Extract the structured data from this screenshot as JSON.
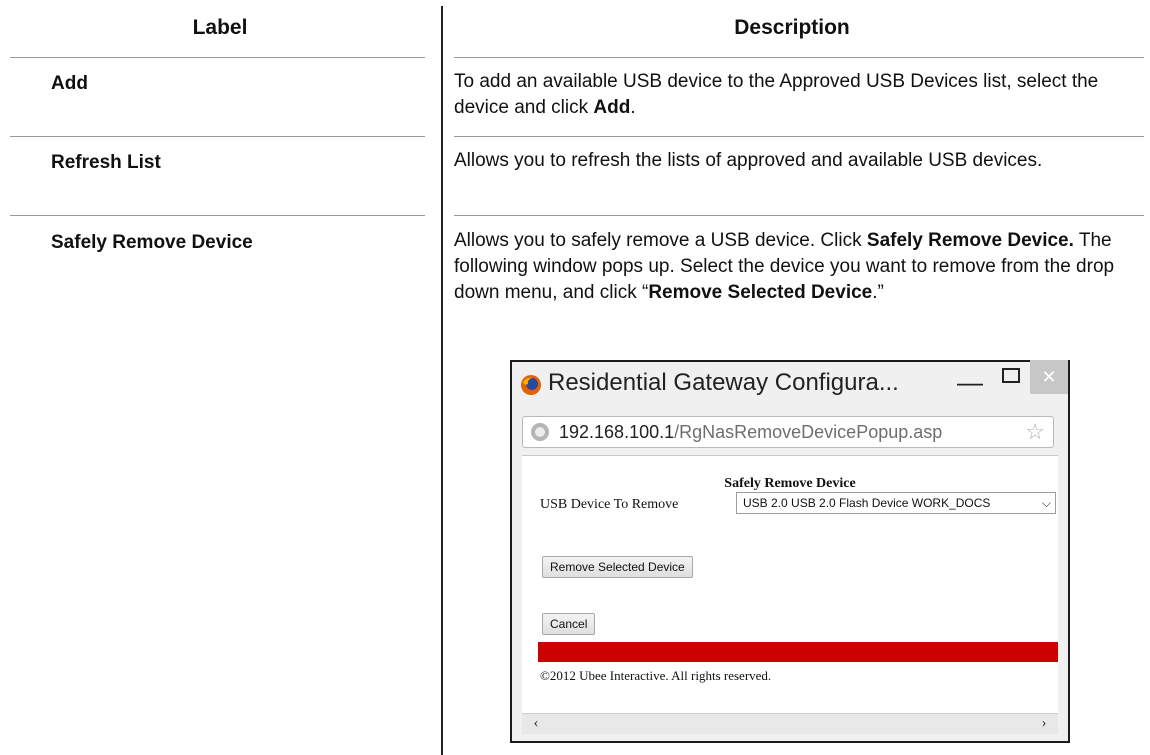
{
  "table": {
    "header_label": "Label",
    "header_description": "Description",
    "rows": [
      {
        "label": "Add",
        "description": [
          {
            "text": "To add an available USB device to the Approved USB Devices list, select the device and click "
          },
          {
            "text": "Add",
            "bold": true
          },
          {
            "text": "."
          }
        ]
      },
      {
        "label": "Refresh List",
        "description": [
          {
            "text": "Allows you to refresh the lists of approved and available USB devices."
          }
        ]
      },
      {
        "label": "Safely Remove Device",
        "description": [
          {
            "text": "Allows you to safely remove a USB device. Click "
          },
          {
            "text": "Safely Remove Device.",
            "bold": true
          },
          {
            "text": " The following window pops up. Select the device you want to remove from the drop down menu, and click “"
          },
          {
            "text": "Remove Selected Device",
            "bold": true
          },
          {
            "text": ".”"
          }
        ]
      }
    ]
  },
  "popup": {
    "title": "Residential Gateway Configura...",
    "url_host": "192.168.100.1",
    "url_path": "/RgNasRemoveDevicePopup.asp",
    "page_title": "Safely Remove Device",
    "field_label": "USB Device To Remove",
    "select_value": "USB 2.0 USB 2.0 Flash Device WORK_DOCS",
    "remove_button": "Remove Selected Device",
    "cancel_button": "Cancel",
    "copyright": "©2012 Ubee Interactive. All rights reserved.",
    "minimize_glyph": "—",
    "close_glyph": "✕",
    "star_glyph": "☆",
    "scroll_left_glyph": "‹",
    "scroll_right_glyph": "›",
    "select_chevron_glyph": "⌵",
    "icons": [
      "firefox-icon",
      "globe-icon",
      "star-icon",
      "minimize-icon",
      "maximize-icon",
      "close-icon",
      "chevron-down-icon"
    ],
    "accent_color": "#cc0000"
  }
}
